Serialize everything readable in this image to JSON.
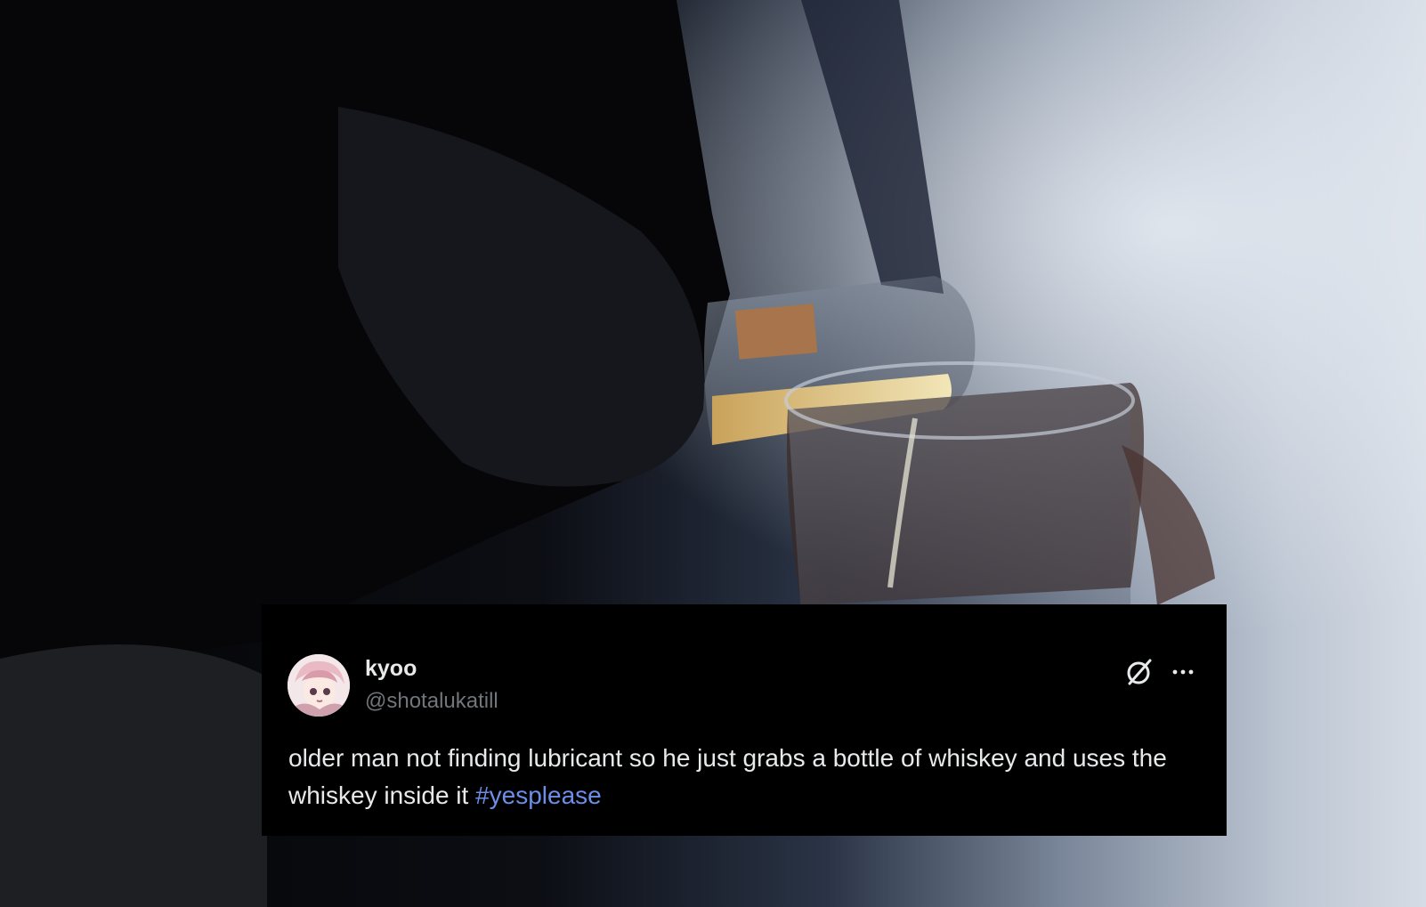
{
  "tweet": {
    "display_name": "kyoo",
    "handle": "@shotalukatill",
    "text": "older man not finding lubricant so he just grabs a bottle of whiskey and uses the whiskey inside it",
    "hashtag": "#yesplease"
  },
  "icons": {
    "grok": "grok-slash-circle-icon",
    "more": "more-horizontal-icon"
  },
  "colors": {
    "card_background": "#000000",
    "name": "#e7e9ea",
    "handle": "#71767b",
    "hashtag": "#6b8ee8"
  }
}
